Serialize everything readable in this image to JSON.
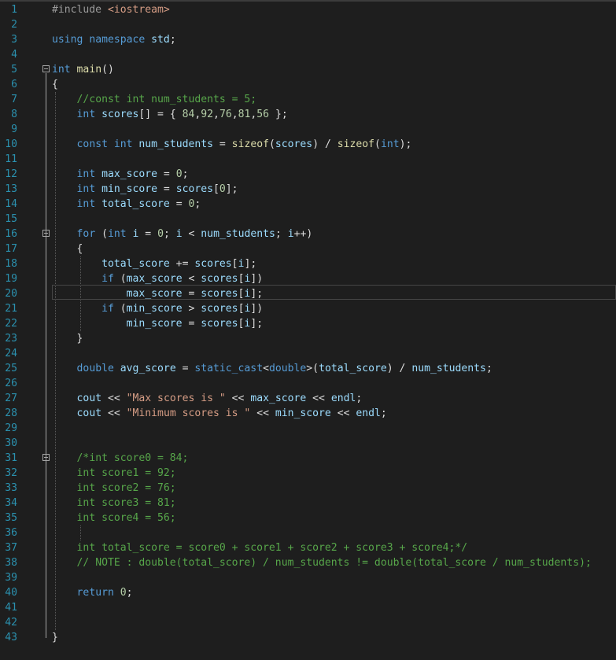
{
  "editor": {
    "line_numbers": [
      "1",
      "2",
      "3",
      "4",
      "5",
      "6",
      "7",
      "8",
      "9",
      "10",
      "11",
      "12",
      "13",
      "14",
      "15",
      "16",
      "17",
      "18",
      "19",
      "20",
      "21",
      "22",
      "23",
      "24",
      "25",
      "26",
      "27",
      "28",
      "29",
      "30",
      "31",
      "32",
      "33",
      "34",
      "35",
      "36",
      "37",
      "38",
      "39",
      "40",
      "41",
      "42",
      "43"
    ],
    "lines": [
      "#include <iostream>",
      "",
      "using namespace std;",
      "",
      "int main()",
      "{",
      "    //const int num_students = 5;",
      "    int scores[] = { 84,92,76,81,56 };",
      "",
      "    const int num_students = sizeof(scores) / sizeof(int);",
      "",
      "    int max_score = 0;",
      "    int min_score = scores[0];",
      "    int total_score = 0;",
      "",
      "    for (int i = 0; i < num_students; i++)",
      "    {",
      "        total_score += scores[i];",
      "        if (max_score < scores[i])",
      "            max_score = scores[i];",
      "        if (min_score > scores[i])",
      "            min_score = scores[i];",
      "    }",
      "",
      "    double avg_score = static_cast<double>(total_score) / num_students;",
      "",
      "    cout << \"Max scores is \" << max_score << endl;",
      "    cout << \"Minimum scores is \" << min_score << endl;",
      "",
      "",
      "    /*int score0 = 84;",
      "    int score1 = 92;",
      "    int score2 = 76;",
      "    int score3 = 81;",
      "    int score4 = 56;",
      "",
      "    int total_score = score0 + score1 + score2 + score3 + score4;*/",
      "    // NOTE : double(total_score) / num_students != double(total_score / num_students);",
      "",
      "    return 0;",
      "",
      "",
      "}"
    ],
    "current_line": 20,
    "fold_markers": [
      5,
      16,
      31
    ],
    "colors": {
      "background": "#1e1e1e",
      "line_number": "#2b91af",
      "keyword": "#569cd6",
      "string": "#d69d85",
      "comment": "#57a64a",
      "function": "#dcdcaa",
      "number": "#b5cea8",
      "variable": "#9cdcfe",
      "text": "#dcdcdc"
    }
  }
}
